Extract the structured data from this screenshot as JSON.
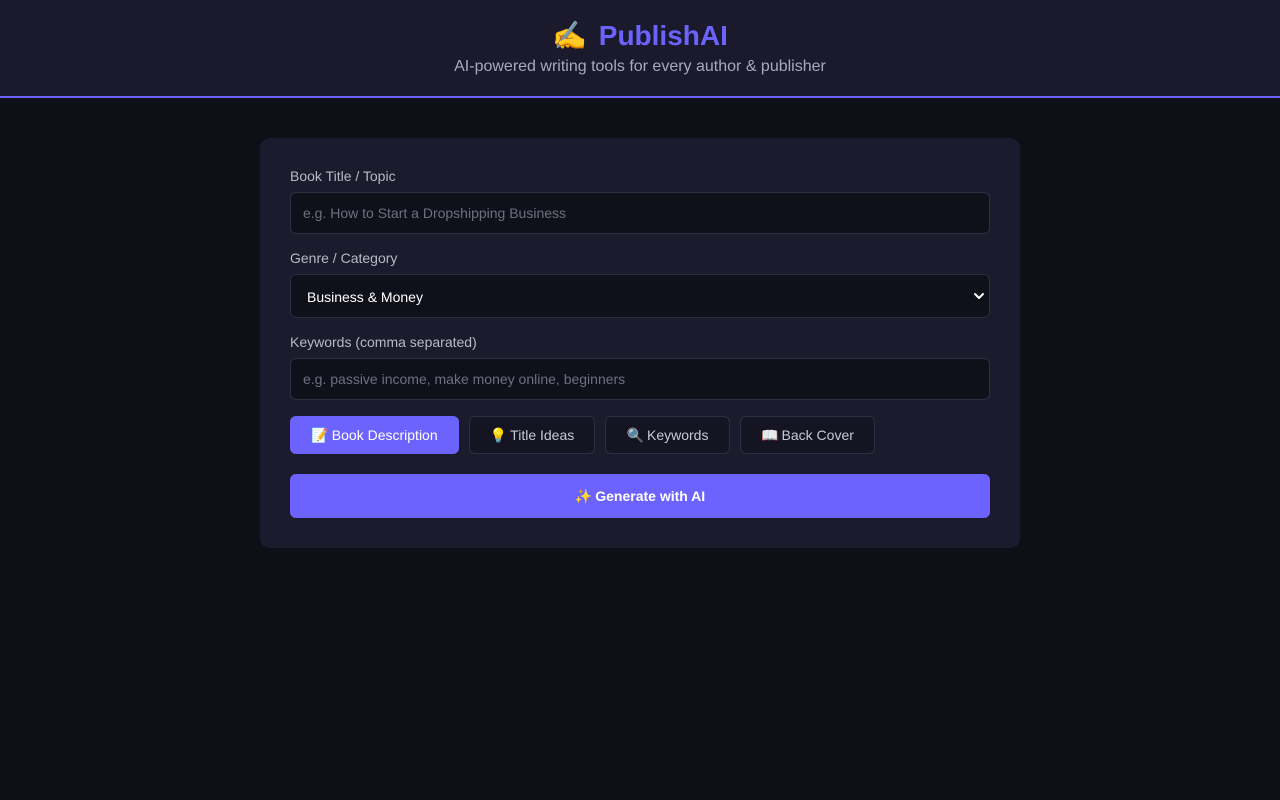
{
  "header": {
    "logo_icon": "✍️",
    "title": "PublishAI",
    "tagline": "AI-powered writing tools for every author & publisher",
    "accent_color": "#6c63ff"
  },
  "form": {
    "title_field": {
      "label": "Book Title / Topic",
      "value": "",
      "placeholder": "e.g. How to Start a Dropshipping Business"
    },
    "genre_field": {
      "label": "Genre / Category",
      "selected": "Business & Money"
    },
    "keywords_field": {
      "label": "Keywords (comma separated)",
      "value": "",
      "placeholder": "e.g. passive income, make money online, beginners"
    }
  },
  "tabs": [
    {
      "icon": "📝",
      "icon_name": "memo-icon",
      "label": "Book Description",
      "active": true
    },
    {
      "icon": "💡",
      "icon_name": "lightbulb-icon",
      "label": "Title Ideas",
      "active": false
    },
    {
      "icon": "🔍",
      "icon_name": "magnifier-icon",
      "label": "Keywords",
      "active": false
    },
    {
      "icon": "📖",
      "icon_name": "open-book-icon",
      "label": "Back Cover",
      "active": false
    }
  ],
  "generate_button": {
    "icon": "✨",
    "label": "Generate with AI"
  }
}
